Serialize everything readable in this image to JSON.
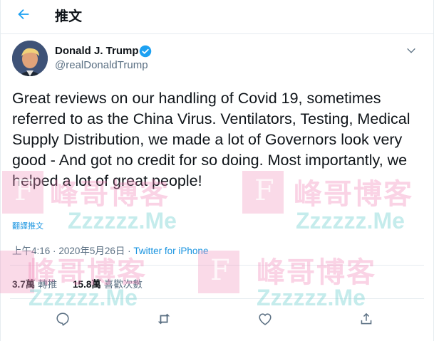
{
  "header": {
    "back_icon": "arrow-left-icon",
    "title": "推文"
  },
  "author": {
    "name": "Donald J. Trump",
    "handle": "@realDonaldTrump",
    "verified_icon": "verified-badge-icon",
    "menu_icon": "chevron-down-icon"
  },
  "tweet": {
    "text": "Great reviews on our handling of Covid 19, sometimes referred to as the China Virus. Ventilators, Testing, Medical Supply Distribution, we made a lot of Governors look very good - And got no credit for so doing. Most importantly, we helped a lot of great people!",
    "translate_label": "翻譯推文"
  },
  "meta": {
    "time": "上午4:16",
    "separator": "·",
    "date": "2020年5月26日",
    "source": "Twitter for iPhone"
  },
  "stats": {
    "retweets_count": "3.7萬",
    "retweets_label": "轉推",
    "likes_count": "15.8萬",
    "likes_label": "喜歡次數"
  },
  "actions": [
    "reply-icon",
    "retweet-icon",
    "like-icon",
    "share-icon"
  ],
  "watermark": {
    "logo_letter": "F",
    "text_cn": "峰哥博客",
    "text_url": "Zzzzzz.Me"
  },
  "colors": {
    "accent": "#1da1f2",
    "text": "#0f1419",
    "secondary": "#5b7083"
  }
}
